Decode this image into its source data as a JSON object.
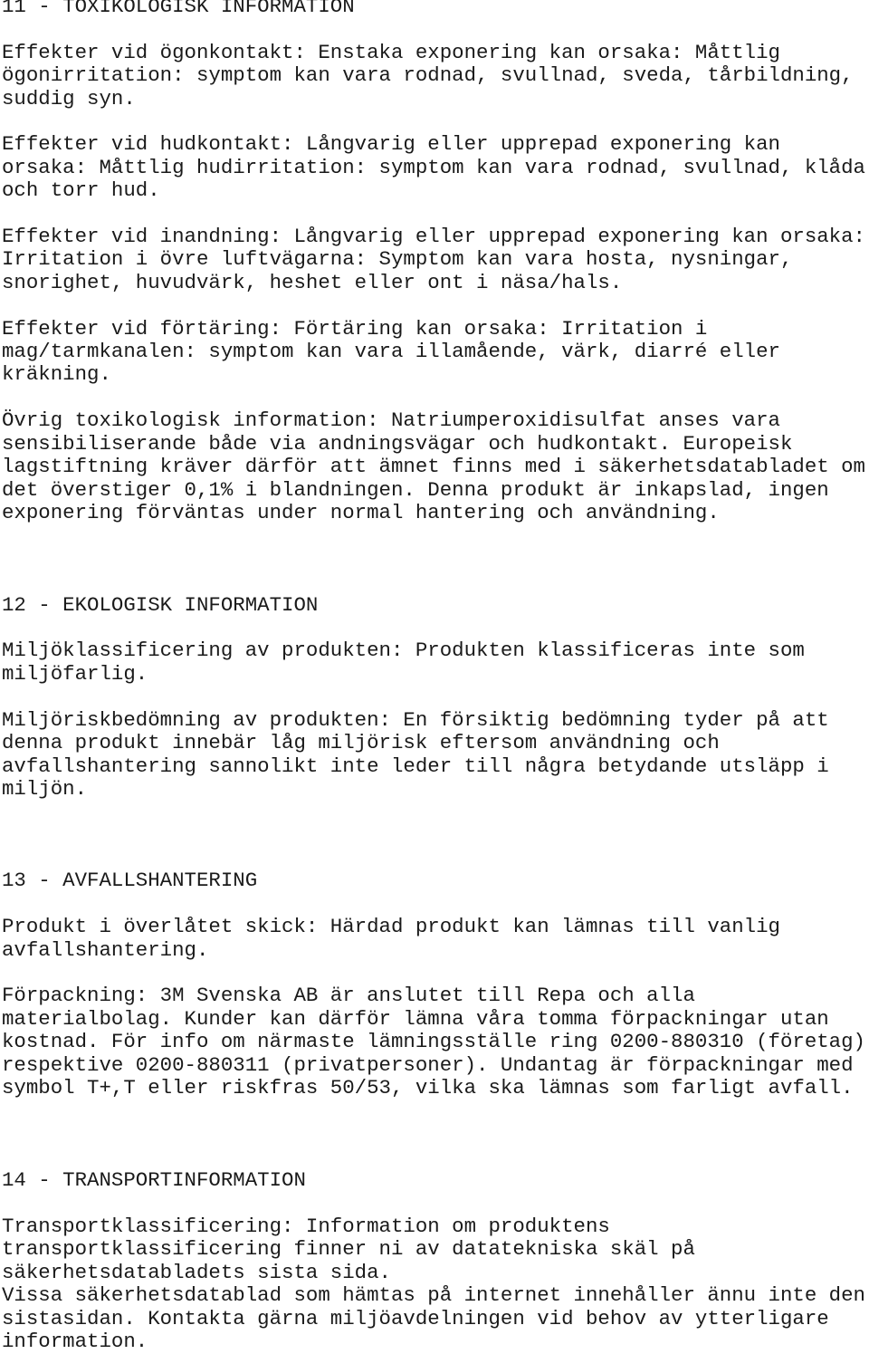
{
  "sections": [
    {
      "heading": "11 - TOXIKOLOGISK INFORMATION",
      "paragraphs": [
        [
          "Effekter vid ögonkontakt: Enstaka exponering kan orsaka: Måttlig",
          "ögonirritation: symptom kan vara rodnad, svullnad, sveda, tårbildning,",
          "suddig syn."
        ],
        [
          "Effekter vid hudkontakt: Långvarig eller upprepad exponering kan",
          "orsaka: Måttlig hudirritation: symptom kan vara rodnad, svullnad, klåda",
          "och torr hud."
        ],
        [
          "Effekter vid inandning: Långvarig eller upprepad exponering kan orsaka:",
          "Irritation i övre luftvägarna: Symptom kan vara hosta, nysningar,",
          "snorighet, huvudvärk, heshet eller ont i näsa/hals."
        ],
        [
          "Effekter vid förtäring: Förtäring kan orsaka: Irritation i",
          "mag/tarmkanalen: symptom kan vara illamående, värk, diarré eller",
          "kräkning."
        ],
        [
          "Övrig toxikologisk information: Natriumperoxidisulfat anses vara",
          "sensibiliserande både via andningsvägar och hudkontakt. Europeisk",
          "lagstiftning kräver därför att ämnet finns med i säkerhetsdatabladet om",
          "det överstiger 0,1% i blandningen. Denna produkt är inkapslad, ingen",
          "exponering förväntas under normal hantering och användning."
        ]
      ]
    },
    {
      "heading": "12 - EKOLOGISK INFORMATION",
      "paragraphs": [
        [
          "Miljöklassificering av produkten: Produkten klassificeras inte som",
          "miljöfarlig."
        ],
        [
          "Miljöriskbedömning av produkten: En försiktig bedömning tyder på att",
          "denna produkt innebär låg miljörisk eftersom användning och",
          "avfallshantering sannolikt inte leder till några betydande utsläpp i",
          "miljön."
        ]
      ]
    },
    {
      "heading": "13 - AVFALLSHANTERING",
      "paragraphs": [
        [
          "Produkt i överlåtet skick: Härdad produkt kan lämnas till vanlig",
          "avfallshantering."
        ],
        [
          "Förpackning: 3M Svenska AB är anslutet till Repa och alla",
          "materialbolag. Kunder kan därför lämna våra tomma förpackningar utan",
          "kostnad. För info om närmaste lämningsställe ring 0200-880310 (företag)",
          "respektive 0200-880311 (privatpersoner). Undantag är förpackningar med",
          "symbol T+,T eller riskfras 50/53, vilka ska lämnas som farligt avfall."
        ]
      ]
    },
    {
      "heading": "14 - TRANSPORTINFORMATION",
      "paragraphs": [
        [
          "Transportklassificering: Information om produktens",
          "transportklassificering finner ni av datatekniska skäl på",
          "säkerhetsdatabladets sista sida.",
          "Vissa säkerhetsdatablad som hämtas på internet innehåller ännu inte den",
          "sistasidan. Kontakta gärna miljöavdelningen vid behov av ytterligare",
          "information."
        ]
      ]
    }
  ]
}
